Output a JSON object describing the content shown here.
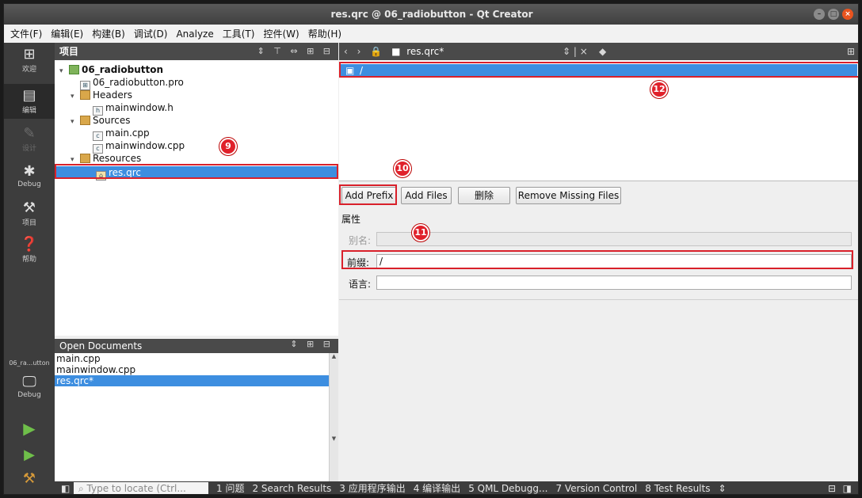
{
  "window": {
    "title": "res.qrc @ 06_radiobutton - Qt Creator"
  },
  "menubar": [
    "文件(F)",
    "编辑(E)",
    "构建(B)",
    "调试(D)",
    "Analyze",
    "工具(T)",
    "控件(W)",
    "帮助(H)"
  ],
  "modes": [
    {
      "label": "欢迎",
      "icon": "grid-icon"
    },
    {
      "label": "编辑",
      "icon": "edit-icon"
    },
    {
      "label": "设计",
      "icon": "pencil-icon"
    },
    {
      "label": "Debug",
      "icon": "bug-icon"
    },
    {
      "label": "项目",
      "icon": "wrench-icon"
    },
    {
      "label": "帮助",
      "icon": "help-icon"
    }
  ],
  "kit": {
    "project": "06_ra...utton",
    "build": "Debug"
  },
  "project_pane": {
    "header": "项目",
    "tree": [
      {
        "label": "06_radiobutton"
      },
      {
        "label": "06_radiobutton.pro"
      },
      {
        "label": "Headers"
      },
      {
        "label": "mainwindow.h"
      },
      {
        "label": "Sources"
      },
      {
        "label": "main.cpp"
      },
      {
        "label": "mainwindow.cpp"
      },
      {
        "label": "Resources"
      },
      {
        "label": "res.qrc"
      }
    ]
  },
  "open_documents": {
    "header": "Open Documents",
    "items": [
      "main.cpp",
      "mainwindow.cpp",
      "res.qrc*"
    ]
  },
  "editor": {
    "tab": "res.qrc*",
    "resource_row": "/",
    "buttons": [
      "Add Prefix",
      "Add Files",
      "删除",
      "Remove Missing Files"
    ],
    "properties_label": "属性",
    "alias_label": "别名:",
    "alias_value": "",
    "prefix_label": "前缀:",
    "prefix_value": "/",
    "language_label": "语言:",
    "language_value": ""
  },
  "statusbar": {
    "locator_placeholder": "Type to locate (Ctrl...",
    "items": [
      "1 问题",
      "2 Search Results",
      "3 应用程序输出",
      "4 编译输出",
      "5 QML Debugg...",
      "7 Version Control",
      "8 Test Results"
    ]
  },
  "annotations": [
    "9",
    "10",
    "11",
    "12"
  ]
}
